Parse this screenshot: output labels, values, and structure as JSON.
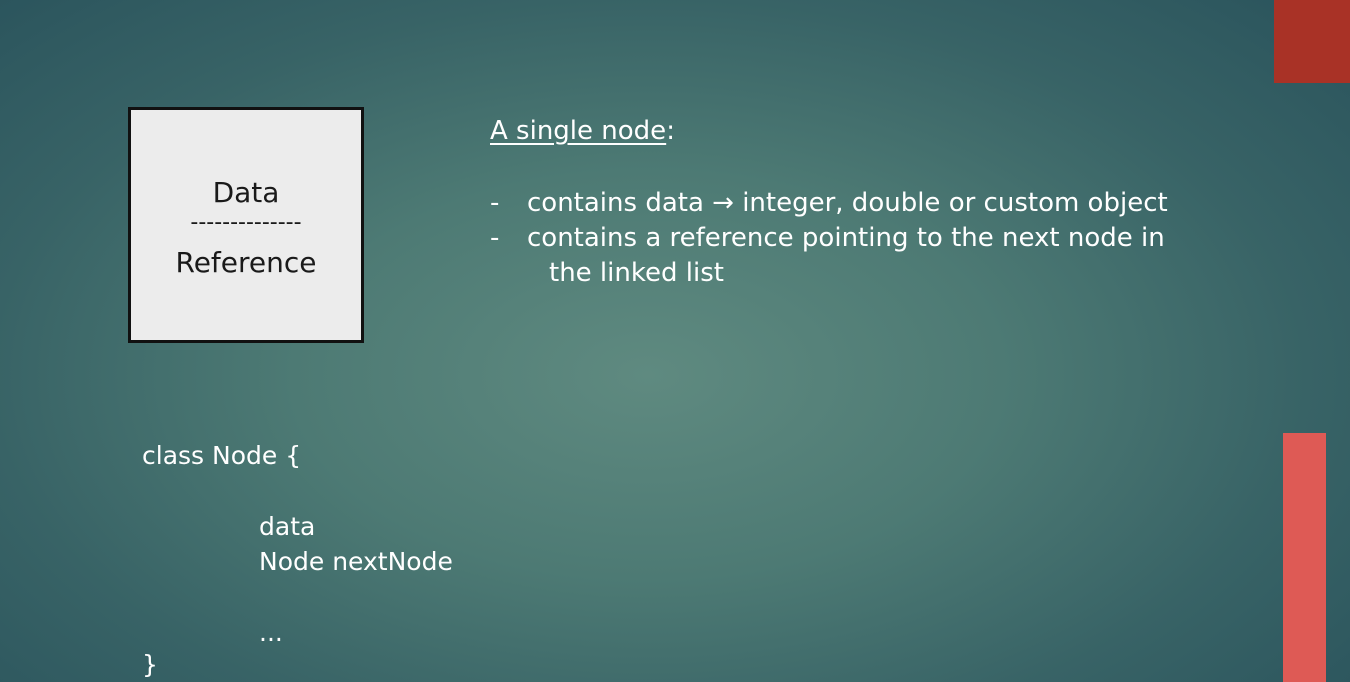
{
  "slide": {
    "accent_colors": {
      "top_block": "#a93226",
      "bottom_bar": "#de5a55",
      "background": "#4d7a74"
    }
  },
  "node_diagram": {
    "data_label": "Data",
    "separator": "--------------",
    "reference_label": "Reference"
  },
  "description": {
    "title_underlined": "A single node",
    "title_suffix": ":",
    "bullets": [
      {
        "dash": "-",
        "text": "contains data → integer, double or custom object"
      },
      {
        "dash": "-",
        "text": "contains a reference pointing to the next node in",
        "continuation": "the linked list"
      }
    ]
  },
  "code": {
    "line1": "class Node {",
    "line2": "data",
    "line3": "Node nextNode",
    "line4": "...",
    "line5": "}"
  }
}
